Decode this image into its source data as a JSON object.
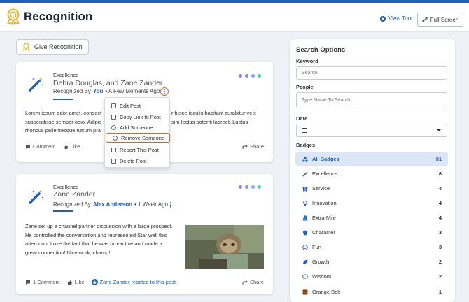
{
  "app": {
    "title": "Recognition",
    "view_tour_label": "View Tour",
    "full_screen_label": "Full Screen"
  },
  "give_recognition_label": "Give Recognition",
  "posts": [
    {
      "badge": "Excellence",
      "names": "Debra Douglas, and Zane Zander",
      "recognized_by_prefix": "Recognized By",
      "recognized_by": "You",
      "time": "• A Few Moments Ago",
      "body_lines": [
        "Lorem ipsum odor amet, consect",
        "suspendisse semper odio. Adipis",
        "rhoncus pellentesque rutrum pra"
      ],
      "body_right_lines": [
        "r fusce iaculis habitant curabitur velit",
        "sim lectus potenti laoreet. Luctus",
        ""
      ],
      "comment_label": "Comment",
      "like_label": "Like",
      "share_label": "Share"
    },
    {
      "badge": "Excellence",
      "names": "Zane Zander",
      "recognized_by_prefix": "Recognized By",
      "recognized_by": "Alex Anderson",
      "time": "• 1 Week Ago",
      "body_lines": [
        "Zane set up a channel partner discussion with a large prospect.",
        "He controlled the conversation and represented Star well this",
        "afternoon. Love the fact that he was pro-active and made a",
        "great connection! Nice work, champ!"
      ],
      "comment_label": "1 Comment",
      "like_label": "Like",
      "reaction_text": "Zane Zander reacted to this post.",
      "share_label": "Share"
    }
  ],
  "post_menu": [
    {
      "label": "Edit Post",
      "icon": "edit-icon"
    },
    {
      "label": "Copy Link to Post",
      "icon": "copy-link-icon"
    },
    {
      "label": "Add Someone",
      "icon": "add-icon"
    },
    {
      "label": "Remove Someone",
      "icon": "remove-icon"
    },
    {
      "label": "Report This Post",
      "icon": "report-icon"
    },
    {
      "label": "Delete Post",
      "icon": "trash-icon"
    }
  ],
  "search": {
    "title": "Search Options",
    "keyword_label": "Keyword",
    "keyword_placeholder": "Search",
    "people_label": "People",
    "people_placeholder": "Type Name To Search",
    "date_label": "Date",
    "badges_label": "Badges",
    "badges": [
      {
        "label": "All Badges",
        "count": "31"
      },
      {
        "label": "Excellence",
        "count": "8"
      },
      {
        "label": "Service",
        "count": "4"
      },
      {
        "label": "Innovation",
        "count": "4"
      },
      {
        "label": "Extra-Mile",
        "count": "4"
      },
      {
        "label": "Character",
        "count": "3"
      },
      {
        "label": "Fun",
        "count": "3"
      },
      {
        "label": "Growth",
        "count": "2"
      },
      {
        "label": "Wisdom",
        "count": "2"
      },
      {
        "label": "Orange Belt",
        "count": "1"
      }
    ]
  },
  "colors": {
    "accent": "#1f5fbf",
    "highlight": "#e0651a",
    "dot_1": "#9b7fe0",
    "dot_2": "#8c8fe0",
    "dot_3": "#7aa5f0",
    "dot_4": "#47d3c4"
  }
}
